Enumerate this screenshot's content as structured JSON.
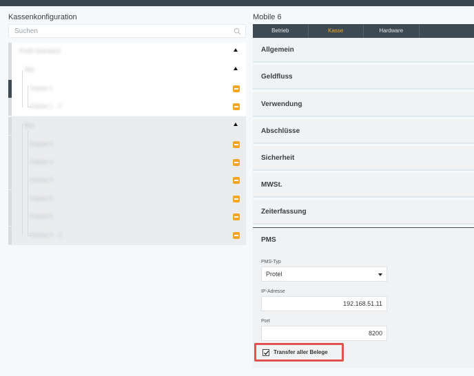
{
  "left": {
    "title": "Kassenkonfiguration",
    "search_placeholder": "Suchen"
  },
  "tree": [
    {
      "label": "Profil Standard",
      "type": "group"
    },
    {
      "label": "Bar",
      "type": "group"
    },
    {
      "label": "Kasse 1",
      "type": "item"
    },
    {
      "label": "Kasse 1 - 2",
      "type": "item"
    },
    {
      "label": "Bar",
      "type": "group"
    },
    {
      "label": "Kasse 3",
      "type": "item"
    },
    {
      "label": "Kasse 4",
      "type": "item"
    },
    {
      "label": "Kasse 5",
      "type": "item"
    },
    {
      "label": "Kasse 6",
      "type": "item"
    },
    {
      "label": "Kasse 6",
      "type": "item"
    },
    {
      "label": "Kasse 6 - 2",
      "type": "item"
    }
  ],
  "right": {
    "title": "Mobile 6",
    "tabs": [
      "Betrieb",
      "Kasse",
      "Hardware"
    ],
    "active_tab": "Kasse",
    "sections": [
      "Allgemein",
      "Geldfluss",
      "Verwendung",
      "Abschlüsse",
      "Sicherheit",
      "MWSt.",
      "Zeiterfassung"
    ],
    "pms": {
      "title": "PMS",
      "pms_type_label": "PMS-Typ",
      "pms_type_value": "Protel",
      "ip_label": "IP-Adresse",
      "ip_value": "192.168.51.11",
      "port_label": "Port",
      "port_value": "8200",
      "transfer_label": "Transfer aller Belege",
      "transfer_checked": true
    }
  },
  "colors": {
    "accent": "#f5a623",
    "dark": "#3d4a53",
    "highlight": "#e0544f"
  }
}
